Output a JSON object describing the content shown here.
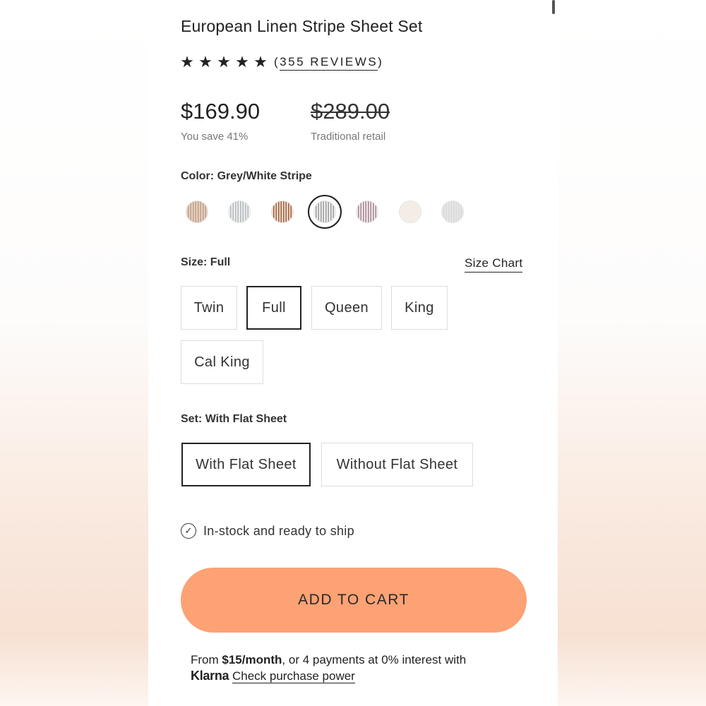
{
  "product": {
    "title": "European Linen Stripe Sheet Set",
    "stars": [
      "★",
      "★",
      "★",
      "★",
      "★"
    ],
    "rating": 5,
    "reviews_open": "(",
    "reviews_label": "355 REVIEWS",
    "reviews_close": ")",
    "price": "$169.90",
    "savings": "You save 41%",
    "original_price": "$289.00",
    "original_label": "Traditional retail"
  },
  "color": {
    "label": "Color:",
    "value": "Grey/White Stripe",
    "swatches": [
      {
        "name": "tan-stripe",
        "c1": "#e9d3c3",
        "c2": "#bd9c85",
        "selected": false
      },
      {
        "name": "grey-stripe-light",
        "c1": "#eef0f1",
        "c2": "#b4b8bb",
        "selected": false
      },
      {
        "name": "rust-stripe",
        "c1": "#f1ddd0",
        "c2": "#9c5e3e",
        "selected": false
      },
      {
        "name": "grey-white-stripe",
        "c1": "#f0f0f0",
        "c2": "#9a9a9a",
        "selected": true
      },
      {
        "name": "mauve-stripe",
        "c1": "#f5eef0",
        "c2": "#9f8089",
        "selected": false
      },
      {
        "name": "cream",
        "c1": "#f4ede6",
        "c2": "#f4ede6",
        "selected": false
      },
      {
        "name": "light-grey",
        "c1": "#e6e6e6",
        "c2": "#d9d9d9",
        "selected": false
      }
    ]
  },
  "size": {
    "label": "Size:",
    "value": "Full",
    "chart_link": "Size Chart",
    "options": [
      "Twin",
      "Full",
      "Queen",
      "King",
      "Cal King"
    ],
    "selected": "Full"
  },
  "set": {
    "label": "Set:",
    "value": "With Flat Sheet",
    "options": [
      "With Flat Sheet",
      "Without Flat Sheet"
    ],
    "selected": "With Flat Sheet"
  },
  "stock": {
    "icon": "check-circle-icon",
    "text": "In-stock and ready to ship"
  },
  "cart": {
    "label": "ADD TO CART",
    "color": "#fca274"
  },
  "klarna": {
    "prefix": "From ",
    "amount": "$15/month",
    "suffix": ", or 4 payments at 0% interest with",
    "brand": "Klarna",
    "link": "Check purchase power"
  }
}
